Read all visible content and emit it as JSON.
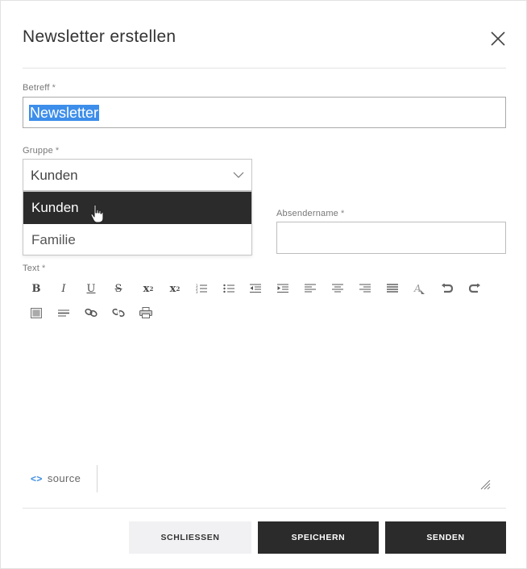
{
  "dialog": {
    "title": "Newsletter erstellen"
  },
  "subject": {
    "label": "Betreff",
    "required_mark": "*",
    "value": "Newsletter"
  },
  "group": {
    "label": "Gruppe",
    "required_mark": "*",
    "selected": "Kunden",
    "options": [
      "Kunden",
      "Familie"
    ]
  },
  "sender": {
    "label": "Absendername",
    "required_mark": "*",
    "value": ""
  },
  "text": {
    "label": "Text",
    "required_mark": "*",
    "toolbar": [
      "bold-icon",
      "italic-icon",
      "underline-icon",
      "strikethrough-icon",
      "subscript-icon",
      "superscript-icon",
      "ordered-list-icon",
      "unordered-list-icon",
      "outdent-icon",
      "indent-icon",
      "align-left-icon",
      "align-center-icon",
      "align-right-icon",
      "justify-icon",
      "remove-format-icon",
      "undo-icon",
      "redo-icon",
      "image-icon",
      "horizontal-rule-icon",
      "link-icon",
      "unlink-icon",
      "print-icon"
    ],
    "source_label": "source",
    "source_glyph": "<>"
  },
  "buttons": {
    "close": "SCHLIESSEN",
    "save": "SPEICHERN",
    "send": "SENDEN"
  },
  "colors": {
    "accent": "#3d8eea",
    "dark": "#2b2b2b",
    "light_button": "#f1f1f3"
  }
}
